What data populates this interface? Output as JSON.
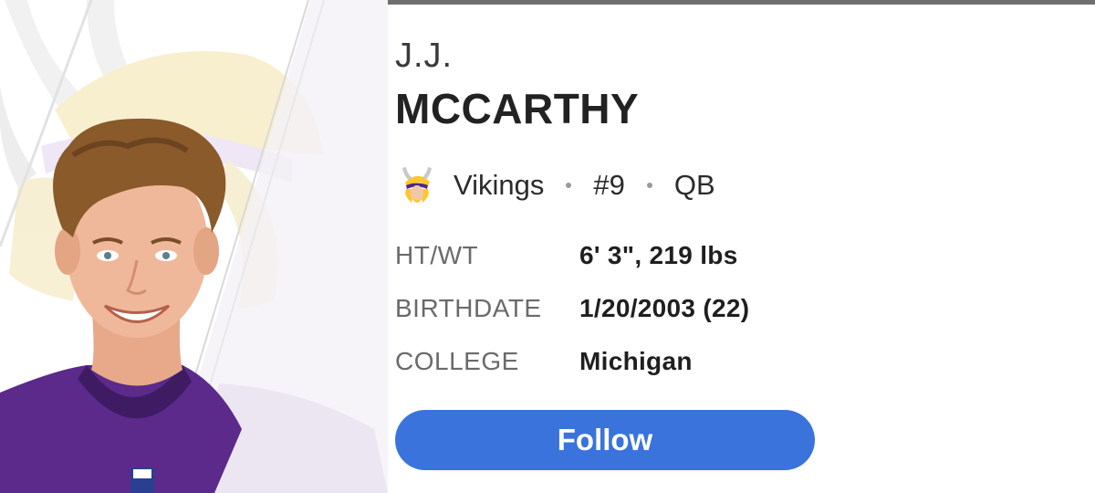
{
  "player": {
    "first_name": "J.J.",
    "last_name": "MCCARTHY",
    "team": "Vikings",
    "number": "#9",
    "position": "QB",
    "team_logo_icon": "vikings-logo-icon",
    "photo": "player-headshot"
  },
  "stats": [
    {
      "label": "HT/WT",
      "value": "6' 3\", 219 lbs"
    },
    {
      "label": "BIRTHDATE",
      "value": "1/20/2003 (22)"
    },
    {
      "label": "COLLEGE",
      "value": "Michigan"
    }
  ],
  "actions": {
    "follow_label": "Follow"
  },
  "colors": {
    "accent": "#3a73dc",
    "team_purple": "#4f2683",
    "team_gold": "#ffc62f"
  }
}
